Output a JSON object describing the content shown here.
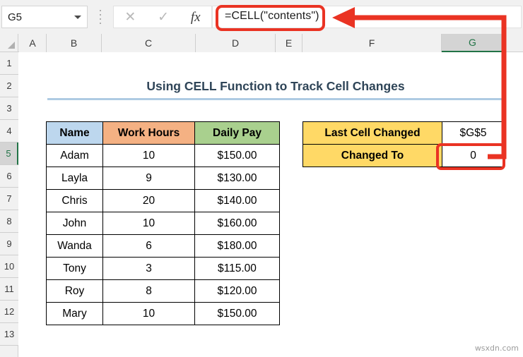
{
  "app": {
    "name_box_value": "G5",
    "formula_value": "=CELL(\"contents\")",
    "cancel_icon": "close-icon",
    "confirm_icon": "check-icon",
    "function_icon": "fx-icon",
    "watermark": "wsxdn.com"
  },
  "grid": {
    "columns": [
      "A",
      "B",
      "C",
      "D",
      "E",
      "F",
      "G"
    ],
    "selected_column": "G",
    "rows": [
      "1",
      "2",
      "3",
      "4",
      "5",
      "6",
      "7",
      "8",
      "9",
      "10",
      "11",
      "12",
      "13"
    ],
    "selected_row": "5"
  },
  "sheet": {
    "title": "Using CELL Function to Track Cell Changes"
  },
  "data_table": {
    "headers": [
      "Name",
      "Work Hours",
      "Daily Pay"
    ],
    "rows": [
      [
        "Adam",
        "10",
        "$150.00"
      ],
      [
        "Layla",
        "9",
        "$130.00"
      ],
      [
        "Chris",
        "20",
        "$140.00"
      ],
      [
        "John",
        "10",
        "$160.00"
      ],
      [
        "Wanda",
        "6",
        "$180.00"
      ],
      [
        "Tony",
        "3",
        "$115.00"
      ],
      [
        "Roy",
        "8",
        "$120.00"
      ],
      [
        "Mary",
        "10",
        "$150.00"
      ]
    ]
  },
  "info_table": {
    "rows": [
      {
        "label": "Last Cell Changed",
        "value": "$G$5"
      },
      {
        "label": "Changed To",
        "value": "0"
      }
    ]
  },
  "colors": {
    "header_name": "#bdd7ee",
    "header_hours": "#f4b183",
    "header_pay": "#a9d08e",
    "info_label": "#ffd966",
    "callout_red": "#ea3323",
    "title_text": "#2f4558",
    "title_rule": "#aecbe3",
    "excel_green": "#217346"
  }
}
